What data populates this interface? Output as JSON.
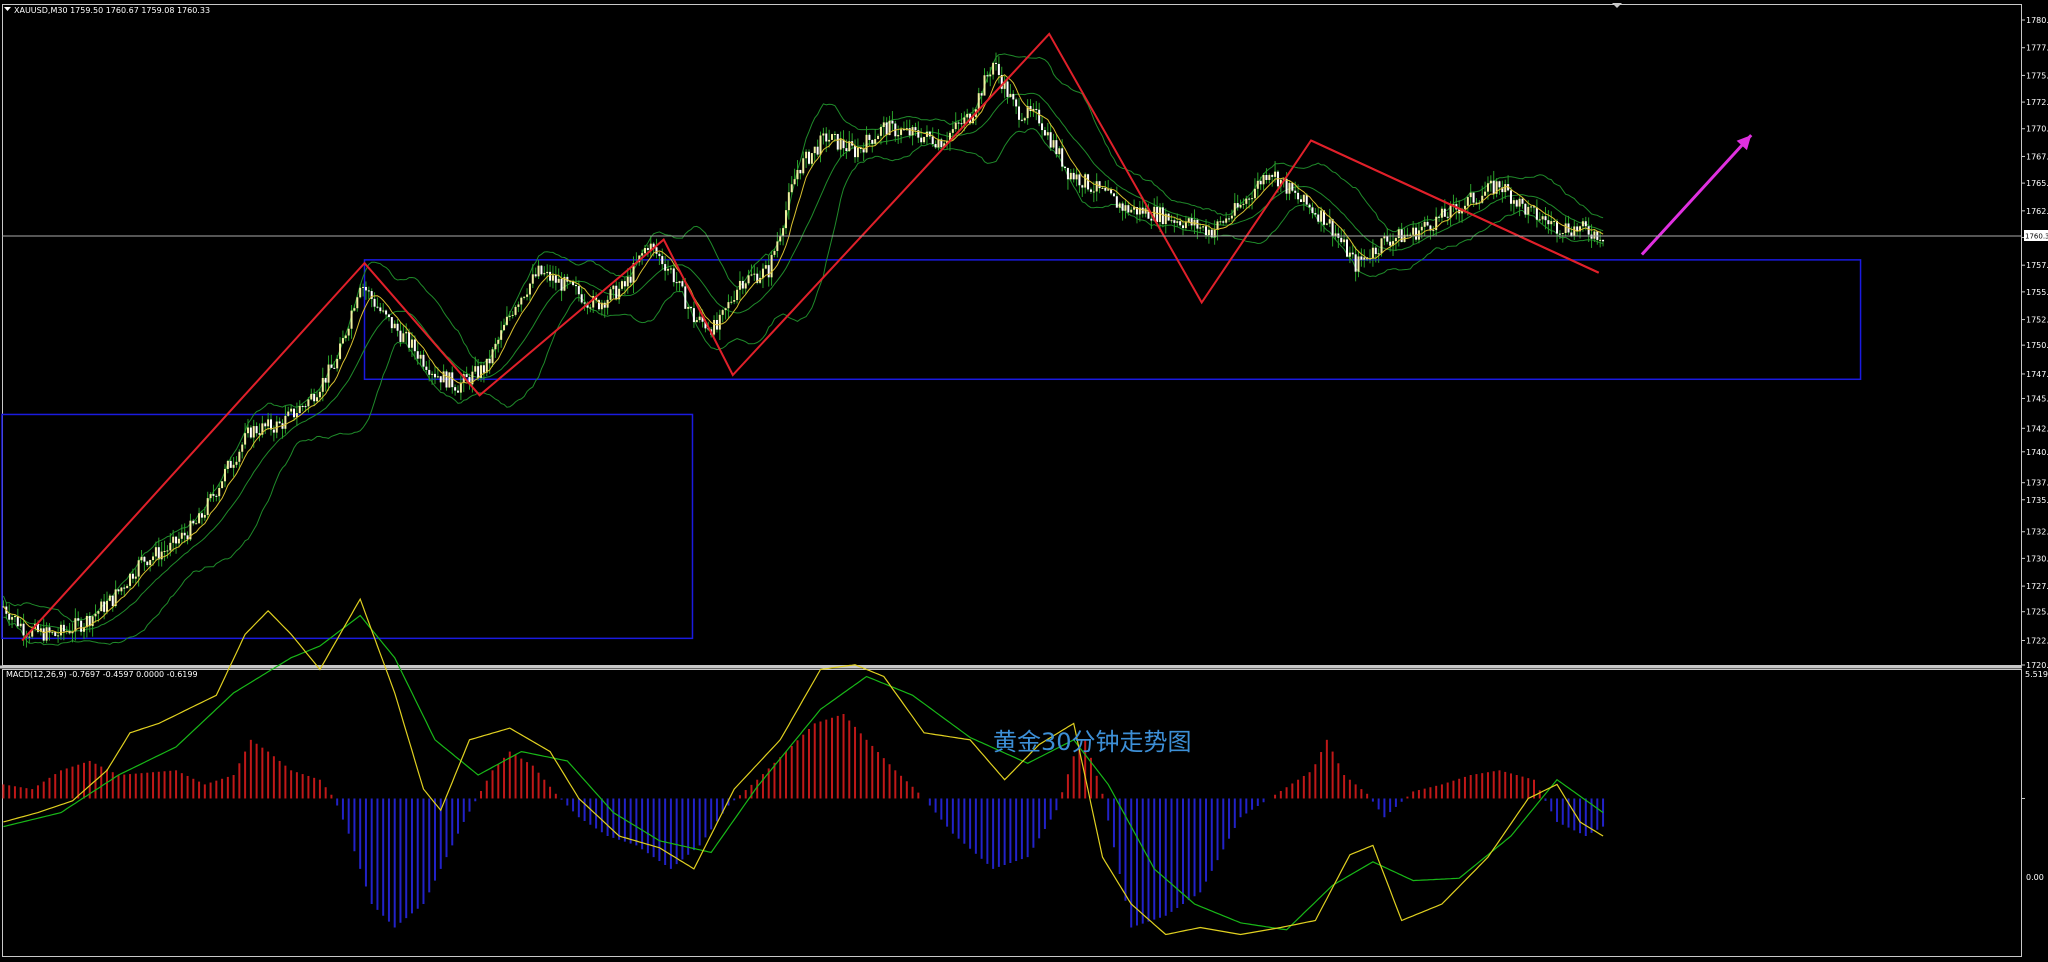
{
  "colors": {
    "background": "#000000",
    "axis": "#c8c8c8",
    "bull_candle": "#f0f0a0",
    "bear_candle": "#ffffff",
    "wick": "#2aa02a",
    "bollinger": "#1f8a2a",
    "ma_fast": "#d8c030",
    "zigzag": "#e0202a",
    "zone_box": "#1a1ae0",
    "macd_pos": "#c01818",
    "macd_neg": "#2222c8",
    "macd_line": "#e0d020",
    "signal_line": "#18b818",
    "arrow": "#e030e0",
    "caption": "#3d8fd6"
  },
  "header": {
    "ohlc_label": "XAUUSD,M30  1759.50 1760.67 1759.08 1760.33",
    "current_price": "1760.33"
  },
  "macd_panel": {
    "label": "MACD(12,26,9) -0.7697 -0.4597 0.0000 -0.6199",
    "top_value": "5.5194",
    "zero_label": "0.00"
  },
  "caption": "黄金30分钟走势图",
  "chart_data": [
    {
      "type": "candlestick",
      "symbol": "XAUUSD",
      "timeframe": "M30",
      "ylim": [
        1720.0,
        1782.0
      ],
      "yticks": [
        "1780.5",
        "1777.9",
        "1775.3",
        "1772.8",
        "1770.3",
        "1767.7",
        "1765.2",
        "1762.6",
        "1760.1",
        "1757.5",
        "1755.0",
        "1752.4",
        "1750.0",
        "1747.3",
        "1745.0",
        "1742.2",
        "1740.0",
        "1737.1",
        "1735.5",
        "1732.5",
        "1730.0",
        "1727.4",
        "1725.0",
        "1722.3",
        "1720.0"
      ],
      "price_path": [
        [
          0,
          1725.5
        ],
        [
          8,
          1723.2
        ],
        [
          18,
          1722.8
        ],
        [
          28,
          1724.0
        ],
        [
          38,
          1726.2
        ],
        [
          48,
          1729.8
        ],
        [
          58,
          1731.0
        ],
        [
          68,
          1733.5
        ],
        [
          78,
          1738.5
        ],
        [
          86,
          1742.0
        ],
        [
          96,
          1742.5
        ],
        [
          106,
          1744.8
        ],
        [
          116,
          1748.5
        ],
        [
          124,
          1756.0
        ],
        [
          132,
          1752.8
        ],
        [
          140,
          1750.5
        ],
        [
          150,
          1747.4
        ],
        [
          158,
          1746.2
        ],
        [
          168,
          1748.0
        ],
        [
          178,
          1754.0
        ],
        [
          186,
          1756.8
        ],
        [
          196,
          1755.5
        ],
        [
          206,
          1753.8
        ],
        [
          216,
          1755.5
        ],
        [
          224,
          1759.5
        ],
        [
          232,
          1757.0
        ],
        [
          240,
          1752.5
        ],
        [
          248,
          1751.5
        ],
        [
          256,
          1756.0
        ],
        [
          266,
          1757.0
        ],
        [
          276,
          1766.5
        ],
        [
          286,
          1769.5
        ],
        [
          296,
          1768.2
        ],
        [
          306,
          1770.4
        ],
        [
          316,
          1769.8
        ],
        [
          326,
          1769.2
        ],
        [
          336,
          1771.5
        ],
        [
          344,
          1776.5
        ],
        [
          352,
          1772.0
        ],
        [
          360,
          1771.3
        ],
        [
          370,
          1766.3
        ],
        [
          380,
          1764.6
        ],
        [
          390,
          1762.8
        ],
        [
          400,
          1762.4
        ],
        [
          410,
          1761.6
        ],
        [
          420,
          1760.7
        ],
        [
          430,
          1763.0
        ],
        [
          440,
          1766.5
        ],
        [
          450,
          1763.7
        ],
        [
          460,
          1761.8
        ],
        [
          470,
          1757.5
        ],
        [
          480,
          1759.8
        ],
        [
          490,
          1760.5
        ],
        [
          500,
          1762.0
        ],
        [
          510,
          1763.6
        ],
        [
          520,
          1765.1
        ],
        [
          530,
          1762.5
        ],
        [
          540,
          1761.2
        ],
        [
          550,
          1760.8
        ],
        [
          556,
          1760.3
        ]
      ],
      "zigzag": [
        [
          7,
          1722.3
        ],
        [
          126,
          1757.7
        ],
        [
          166,
          1745.3
        ],
        [
          230,
          1759.9
        ],
        [
          254,
          1747.2
        ],
        [
          364,
          1779.2
        ],
        [
          417,
          1754.0
        ],
        [
          455,
          1769.2
        ],
        [
          555,
          1756.8
        ]
      ],
      "zones": [
        {
          "x": [
            0,
            240
          ],
          "y": [
            1722.5,
            1743.5
          ]
        },
        {
          "x": [
            126,
            646
          ],
          "y": [
            1746.8,
            1758.0
          ]
        }
      ],
      "trendlines": [
        [
          [
            455,
            1769.2
          ],
          [
            555,
            1756.8
          ]
        ]
      ],
      "arrow": {
        "from": [
          570,
          1758.5
        ],
        "to": [
          608,
          1769.7
        ]
      }
    },
    {
      "type": "bar",
      "title": "MACD(12,26,9) -0.7697 -0.4597 0.0000 -0.6199",
      "ylim": [
        -6.8,
        5.5194
      ],
      "histogram_path": [
        [
          0,
          0.6
        ],
        [
          10,
          0.4
        ],
        [
          20,
          1.2
        ],
        [
          30,
          1.6
        ],
        [
          40,
          1.0
        ],
        [
          50,
          1.1
        ],
        [
          60,
          1.2
        ],
        [
          70,
          0.6
        ],
        [
          80,
          1.0
        ],
        [
          86,
          2.5
        ],
        [
          92,
          2.0
        ],
        [
          100,
          1.2
        ],
        [
          110,
          0.8
        ],
        [
          115,
          0
        ],
        [
          120,
          -1.5
        ],
        [
          128,
          -4.5
        ],
        [
          136,
          -5.5
        ],
        [
          146,
          -4.5
        ],
        [
          160,
          -1.0
        ],
        [
          170,
          1.2
        ],
        [
          176,
          2.0
        ],
        [
          184,
          1.4
        ],
        [
          192,
          0.2
        ],
        [
          200,
          -0.8
        ],
        [
          210,
          -1.6
        ],
        [
          220,
          -2.0
        ],
        [
          232,
          -3.0
        ],
        [
          242,
          -2.0
        ],
        [
          252,
          -0.3
        ],
        [
          262,
          0.8
        ],
        [
          272,
          2.0
        ],
        [
          282,
          3.2
        ],
        [
          292,
          3.6
        ],
        [
          300,
          2.5
        ],
        [
          310,
          1.2
        ],
        [
          316,
          0.5
        ],
        [
          320,
          0
        ],
        [
          330,
          -1.5
        ],
        [
          344,
          -3.0
        ],
        [
          356,
          -2.5
        ],
        [
          366,
          -0.5
        ],
        [
          372,
          1.8
        ],
        [
          376,
          2.5
        ],
        [
          382,
          0.2
        ],
        [
          392,
          -5.5
        ],
        [
          404,
          -5.0
        ],
        [
          416,
          -4.0
        ],
        [
          430,
          -0.8
        ],
        [
          445,
          0.4
        ],
        [
          455,
          1.2
        ],
        [
          460,
          2.5
        ],
        [
          466,
          1.0
        ],
        [
          474,
          0.2
        ],
        [
          480,
          -0.8
        ],
        [
          490,
          0.3
        ],
        [
          500,
          0.6
        ],
        [
          510,
          1.0
        ],
        [
          520,
          1.2
        ],
        [
          532,
          0.8
        ],
        [
          540,
          -1.0
        ],
        [
          550,
          -1.6
        ],
        [
          556,
          -1.2
        ]
      ],
      "macd_line_path": [
        [
          0,
          -1.0
        ],
        [
          12,
          -0.6
        ],
        [
          24,
          -0.1
        ],
        [
          36,
          1.2
        ],
        [
          44,
          2.8
        ],
        [
          54,
          3.2
        ],
        [
          64,
          3.8
        ],
        [
          74,
          4.4
        ],
        [
          84,
          7.0
        ],
        [
          92,
          8.0
        ],
        [
          100,
          7.0
        ],
        [
          110,
          5.5
        ],
        [
          124,
          8.5
        ],
        [
          136,
          4.5
        ],
        [
          146,
          0.4
        ],
        [
          152,
          -0.5
        ],
        [
          162,
          2.5
        ],
        [
          176,
          3.0
        ],
        [
          190,
          2.0
        ],
        [
          200,
          0
        ],
        [
          214,
          -1.6
        ],
        [
          228,
          -2.1
        ],
        [
          240,
          -3.0
        ],
        [
          254,
          0.4
        ],
        [
          270,
          2.5
        ],
        [
          284,
          5.5
        ],
        [
          296,
          5.7
        ],
        [
          306,
          5.2
        ],
        [
          320,
          2.8
        ],
        [
          336,
          2.5
        ],
        [
          348,
          0.8
        ],
        [
          360,
          2.3
        ],
        [
          372,
          3.2
        ],
        [
          382,
          -2.5
        ],
        [
          392,
          -4.5
        ],
        [
          404,
          -5.8
        ],
        [
          416,
          -5.5
        ],
        [
          430,
          -5.8
        ],
        [
          444,
          -5.5
        ],
        [
          456,
          -5.2
        ],
        [
          468,
          -2.4
        ],
        [
          476,
          -2.0
        ],
        [
          486,
          -5.2
        ],
        [
          500,
          -4.5
        ],
        [
          516,
          -2.5
        ],
        [
          530,
          0
        ],
        [
          540,
          0.6
        ],
        [
          548,
          -1.0
        ],
        [
          556,
          -1.6
        ]
      ],
      "signal_line_path": [
        [
          0,
          -1.2
        ],
        [
          20,
          -0.6
        ],
        [
          40,
          1.0
        ],
        [
          60,
          2.2
        ],
        [
          80,
          4.5
        ],
        [
          100,
          6.0
        ],
        [
          110,
          6.5
        ],
        [
          124,
          7.8
        ],
        [
          136,
          6.0
        ],
        [
          150,
          2.5
        ],
        [
          165,
          1.0
        ],
        [
          180,
          2.0
        ],
        [
          196,
          1.6
        ],
        [
          212,
          -0.6
        ],
        [
          228,
          -1.8
        ],
        [
          246,
          -2.3
        ],
        [
          262,
          0.5
        ],
        [
          284,
          3.8
        ],
        [
          300,
          5.2
        ],
        [
          316,
          4.4
        ],
        [
          336,
          2.6
        ],
        [
          356,
          1.5
        ],
        [
          372,
          2.5
        ],
        [
          384,
          0.6
        ],
        [
          400,
          -3.0
        ],
        [
          414,
          -4.5
        ],
        [
          430,
          -5.3
        ],
        [
          446,
          -5.6
        ],
        [
          462,
          -3.7
        ],
        [
          476,
          -2.7
        ],
        [
          490,
          -3.5
        ],
        [
          506,
          -3.4
        ],
        [
          524,
          -1.6
        ],
        [
          540,
          0.8
        ],
        [
          556,
          -0.6
        ]
      ]
    }
  ]
}
